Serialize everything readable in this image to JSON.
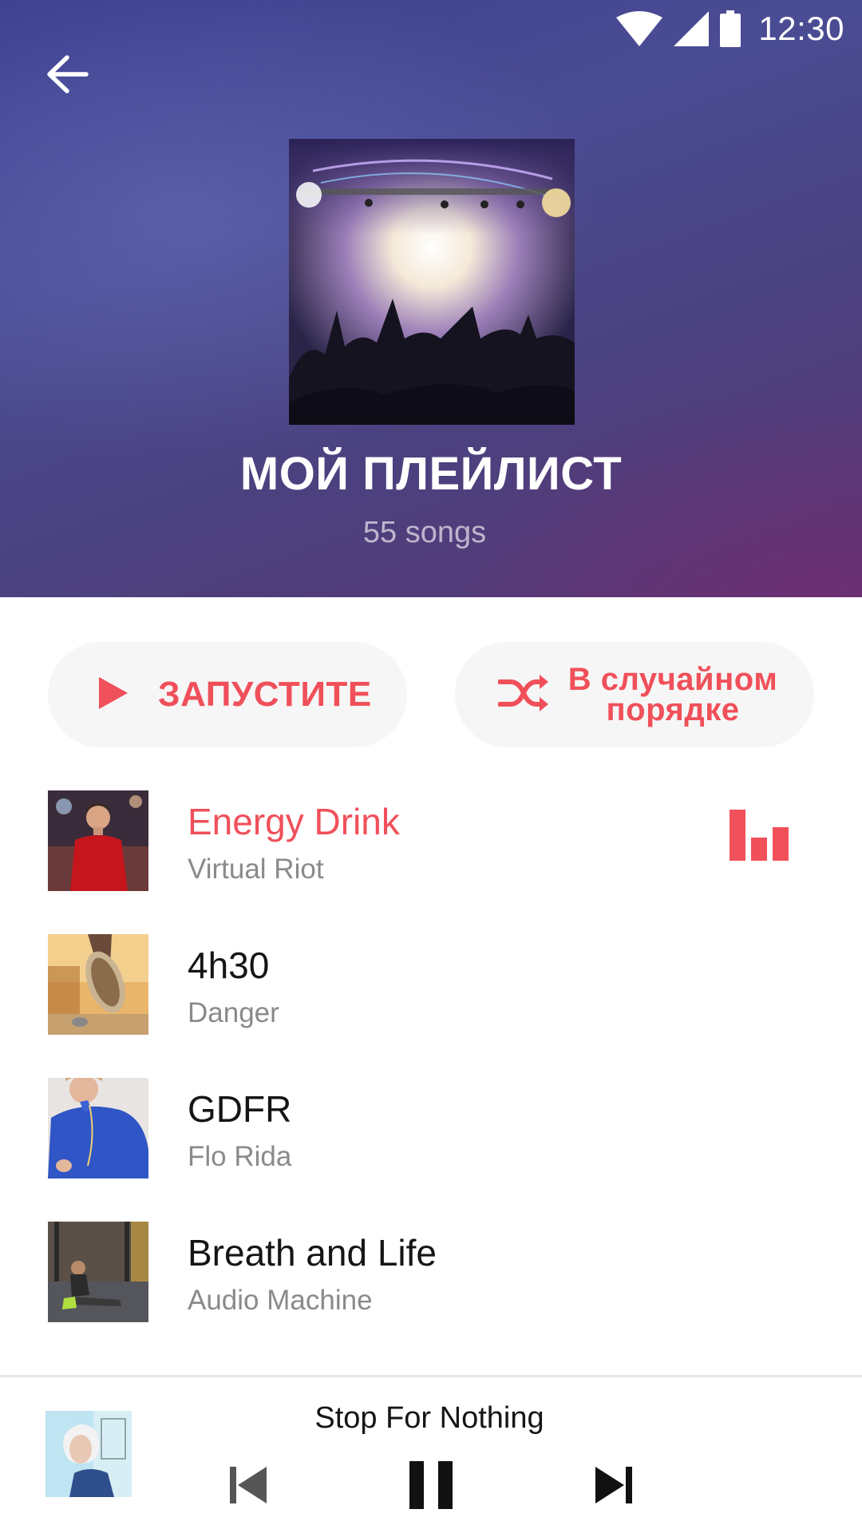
{
  "status_bar": {
    "time": "12:30",
    "icons": [
      "wifi-icon",
      "cellular-signal-icon",
      "battery-icon"
    ]
  },
  "header": {
    "back_icon": "arrow-left-icon",
    "playlist_title": "МОЙ ПЛЕЙЛИСТ",
    "song_count": "55 songs"
  },
  "actions": {
    "play_label": "ЗАПУСТИТЕ",
    "play_icon": "play-icon",
    "shuffle_label_line1": "В случайном",
    "shuffle_label_line2": "порядке",
    "shuffle_icon": "shuffle-icon"
  },
  "songs": [
    {
      "title": "Energy Drink",
      "artist": "Virtual Riot",
      "playing": true
    },
    {
      "title": "4h30",
      "artist": "Danger",
      "playing": false
    },
    {
      "title": "GDFR",
      "artist": "Flo Rida",
      "playing": false
    },
    {
      "title": "Breath and Life",
      "artist": "Audio Machine",
      "playing": false
    }
  ],
  "mini_player": {
    "title": "Stop For Nothing",
    "controls": [
      "skip-previous-icon",
      "pause-icon",
      "skip-next-icon"
    ]
  },
  "colors": {
    "accent": "#f0505a",
    "header_start": "#3d3f8f",
    "header_end": "#5b3674",
    "button_bg": "#f6f6f6"
  }
}
